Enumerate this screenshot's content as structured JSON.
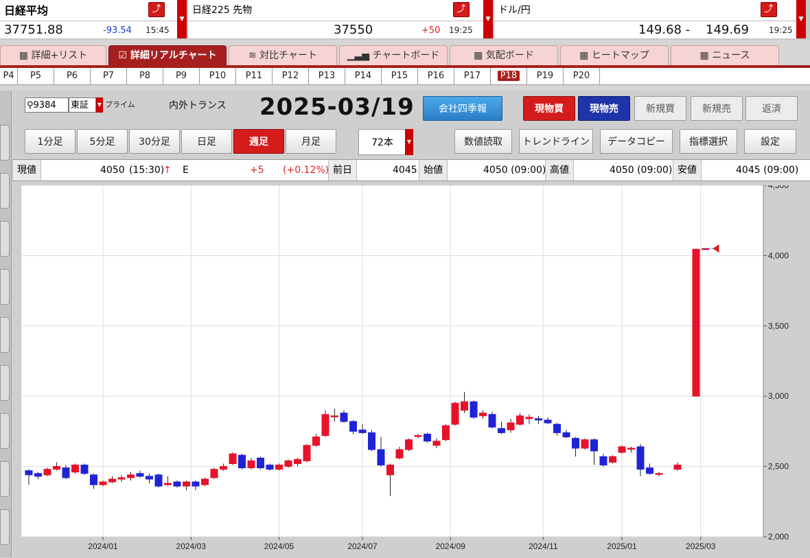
{
  "ticker": [
    {
      "name": "日経平均",
      "value": "37751.88",
      "change": "-93.54",
      "time": "15:45"
    },
    {
      "name": "日経225 先物",
      "value": "37550",
      "change": "+50",
      "time": "19:25"
    },
    {
      "name": "ドル/円",
      "value": "149.68 -",
      "value2": "149.69",
      "time": "19:25"
    }
  ],
  "tabs": [
    {
      "label": "詳細+リスト",
      "icon": "grid-icon"
    },
    {
      "label": "詳細リアルチャート",
      "icon": "chart-icon",
      "active": true
    },
    {
      "label": "対比チャート",
      "icon": "compare-icon"
    },
    {
      "label": "チャートボード",
      "icon": "bar-icon"
    },
    {
      "label": "気配ボード",
      "icon": "grid-icon"
    },
    {
      "label": "ヒートマップ",
      "icon": "heatmap-icon"
    },
    {
      "label": "ニュース",
      "icon": "grid-icon"
    }
  ],
  "pages": [
    "P4",
    "P5",
    "P6",
    "P7",
    "P8",
    "P9",
    "P10",
    "P11",
    "P12",
    "P13",
    "P14",
    "P15",
    "P16",
    "P17",
    "P18",
    "P19",
    "P20"
  ],
  "active_page": "P18",
  "stock": {
    "code": "9384",
    "market": "東証",
    "segment": "プライム",
    "name": "内外トランス",
    "date": "2025-03/19"
  },
  "buttons": {
    "quarterly": "会社四季報",
    "cash_buy": "現物買",
    "cash_sell": "現物売",
    "margin_buy": "新規買",
    "margin_sell": "新規売",
    "repay": "返済",
    "read_values": "数値読取",
    "trendline": "トレンドライン",
    "copy_data": "データコピー",
    "indicator": "指標選択",
    "settings": "設定"
  },
  "timeframes": [
    "1分足",
    "5分足",
    "30分足",
    "日足",
    "週足",
    "月足"
  ],
  "active_timeframe": "週足",
  "bar_count": "72本",
  "quote": {
    "current_label": "現値",
    "current": "4050",
    "current_time": "(15:30)",
    "arrow": "↑",
    "flag": "E",
    "change": "+5",
    "change_pct": "(+0.12%)",
    "prev_label": "前日",
    "prev": "4045",
    "open_label": "始値",
    "open": "4050 (09:00)",
    "high_label": "高値",
    "high": "4050 (09:00)",
    "low_label": "安値",
    "low": "4045 (09:00)"
  },
  "colors": {
    "up": "#e8112a",
    "down": "#1f23d6",
    "accent": "#a71f1f"
  },
  "chart_data": {
    "type": "candlestick",
    "x_ticks": [
      "2024/01",
      "2024/03",
      "2024/05",
      "2024/07",
      "2024/09",
      "2024/11",
      "2025/01",
      "2025/03"
    ],
    "y_ticks": [
      "2,000",
      "2,500",
      "3,000",
      "3,500",
      "4,000",
      "4,500"
    ],
    "ylim": [
      2000,
      4500
    ],
    "grid": true,
    "candles": [
      {
        "o": 2470,
        "c": 2440,
        "h": 2480,
        "l": 2370
      },
      {
        "o": 2450,
        "c": 2430,
        "h": 2460,
        "l": 2410
      },
      {
        "o": 2440,
        "c": 2480,
        "h": 2490,
        "l": 2430
      },
      {
        "o": 2480,
        "c": 2500,
        "h": 2530,
        "l": 2470
      },
      {
        "o": 2490,
        "c": 2420,
        "h": 2510,
        "l": 2410
      },
      {
        "o": 2460,
        "c": 2510,
        "h": 2520,
        "l": 2450
      },
      {
        "o": 2510,
        "c": 2450,
        "h": 2520,
        "l": 2440
      },
      {
        "o": 2440,
        "c": 2370,
        "h": 2450,
        "l": 2340
      },
      {
        "o": 2370,
        "c": 2390,
        "h": 2400,
        "l": 2360
      },
      {
        "o": 2390,
        "c": 2410,
        "h": 2430,
        "l": 2380
      },
      {
        "o": 2410,
        "c": 2420,
        "h": 2440,
        "l": 2390
      },
      {
        "o": 2420,
        "c": 2440,
        "h": 2460,
        "l": 2400
      },
      {
        "o": 2450,
        "c": 2430,
        "h": 2470,
        "l": 2420
      },
      {
        "o": 2430,
        "c": 2410,
        "h": 2450,
        "l": 2380
      },
      {
        "o": 2440,
        "c": 2360,
        "h": 2450,
        "l": 2350
      },
      {
        "o": 2370,
        "c": 2380,
        "h": 2430,
        "l": 2360
      },
      {
        "o": 2390,
        "c": 2360,
        "h": 2400,
        "l": 2350
      },
      {
        "o": 2360,
        "c": 2390,
        "h": 2400,
        "l": 2330
      },
      {
        "o": 2390,
        "c": 2360,
        "h": 2400,
        "l": 2330
      },
      {
        "o": 2370,
        "c": 2410,
        "h": 2420,
        "l": 2360
      },
      {
        "o": 2420,
        "c": 2480,
        "h": 2490,
        "l": 2410
      },
      {
        "o": 2480,
        "c": 2500,
        "h": 2520,
        "l": 2470
      },
      {
        "o": 2520,
        "c": 2590,
        "h": 2600,
        "l": 2510
      },
      {
        "o": 2580,
        "c": 2490,
        "h": 2590,
        "l": 2480
      },
      {
        "o": 2490,
        "c": 2540,
        "h": 2560,
        "l": 2480
      },
      {
        "o": 2560,
        "c": 2490,
        "h": 2570,
        "l": 2480
      },
      {
        "o": 2510,
        "c": 2480,
        "h": 2520,
        "l": 2470
      },
      {
        "o": 2480,
        "c": 2510,
        "h": 2520,
        "l": 2470
      },
      {
        "o": 2500,
        "c": 2540,
        "h": 2550,
        "l": 2490
      },
      {
        "o": 2520,
        "c": 2550,
        "h": 2560,
        "l": 2500
      },
      {
        "o": 2540,
        "c": 2650,
        "h": 2660,
        "l": 2530
      },
      {
        "o": 2650,
        "c": 2710,
        "h": 2730,
        "l": 2640
      },
      {
        "o": 2720,
        "c": 2870,
        "h": 2900,
        "l": 2710
      },
      {
        "o": 2860,
        "c": 2860,
        "h": 2910,
        "l": 2820
      },
      {
        "o": 2880,
        "c": 2820,
        "h": 2900,
        "l": 2810
      },
      {
        "o": 2820,
        "c": 2750,
        "h": 2830,
        "l": 2730
      },
      {
        "o": 2760,
        "c": 2740,
        "h": 2800,
        "l": 2730
      },
      {
        "o": 2740,
        "c": 2620,
        "h": 2760,
        "l": 2610
      },
      {
        "o": 2620,
        "c": 2510,
        "h": 2710,
        "l": 2500
      },
      {
        "o": 2440,
        "c": 2510,
        "h": 2520,
        "l": 2290
      },
      {
        "o": 2560,
        "c": 2620,
        "h": 2640,
        "l": 2550
      },
      {
        "o": 2620,
        "c": 2690,
        "h": 2700,
        "l": 2610
      },
      {
        "o": 2720,
        "c": 2720,
        "h": 2730,
        "l": 2700
      },
      {
        "o": 2730,
        "c": 2680,
        "h": 2740,
        "l": 2670
      },
      {
        "o": 2650,
        "c": 2680,
        "h": 2700,
        "l": 2630
      },
      {
        "o": 2690,
        "c": 2790,
        "h": 2800,
        "l": 2680
      },
      {
        "o": 2800,
        "c": 2950,
        "h": 2960,
        "l": 2790
      },
      {
        "o": 2900,
        "c": 2960,
        "h": 3030,
        "l": 2880
      },
      {
        "o": 2960,
        "c": 2850,
        "h": 2970,
        "l": 2840
      },
      {
        "o": 2860,
        "c": 2880,
        "h": 2900,
        "l": 2840
      },
      {
        "o": 2870,
        "c": 2780,
        "h": 2890,
        "l": 2770
      },
      {
        "o": 2770,
        "c": 2740,
        "h": 2820,
        "l": 2730
      },
      {
        "o": 2760,
        "c": 2810,
        "h": 2840,
        "l": 2740
      },
      {
        "o": 2800,
        "c": 2860,
        "h": 2880,
        "l": 2790
      },
      {
        "o": 2840,
        "c": 2850,
        "h": 2870,
        "l": 2800
      },
      {
        "o": 2840,
        "c": 2830,
        "h": 2860,
        "l": 2800
      },
      {
        "o": 2830,
        "c": 2810,
        "h": 2850,
        "l": 2800
      },
      {
        "o": 2800,
        "c": 2740,
        "h": 2810,
        "l": 2720
      },
      {
        "o": 2740,
        "c": 2710,
        "h": 2760,
        "l": 2700
      },
      {
        "o": 2700,
        "c": 2630,
        "h": 2710,
        "l": 2570
      },
      {
        "o": 2630,
        "c": 2690,
        "h": 2700,
        "l": 2620
      },
      {
        "o": 2690,
        "c": 2610,
        "h": 2700,
        "l": 2510
      },
      {
        "o": 2570,
        "c": 2510,
        "h": 2590,
        "l": 2500
      },
      {
        "o": 2530,
        "c": 2570,
        "h": 2580,
        "l": 2520
      },
      {
        "o": 2600,
        "c": 2640,
        "h": 2650,
        "l": 2590
      },
      {
        "o": 2630,
        "c": 2630,
        "h": 2640,
        "l": 2600
      },
      {
        "o": 2640,
        "c": 2480,
        "h": 2660,
        "l": 2430
      },
      {
        "o": 2490,
        "c": 2450,
        "h": 2520,
        "l": 2440
      },
      {
        "o": 2450,
        "c": 2450,
        "h": 2460,
        "l": 2430
      },
      null,
      {
        "o": 2480,
        "c": 2510,
        "h": 2530,
        "l": 2470
      },
      null,
      {
        "o": 3000,
        "c": 4045,
        "h": 4050,
        "l": 3000
      },
      {
        "o": 4050,
        "c": 4050,
        "h": 4050,
        "l": 4045
      }
    ],
    "last_price": 4050
  }
}
